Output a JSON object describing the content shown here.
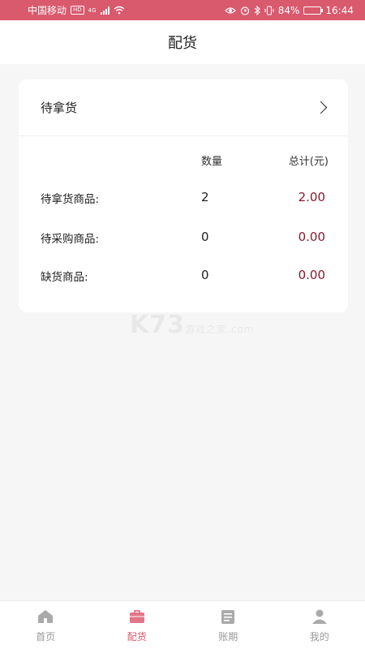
{
  "status_bar": {
    "carrier": "中国移动",
    "hd": "HD",
    "network": "4G",
    "battery": "84%",
    "battery_level": 0.84,
    "time": "16:44"
  },
  "header": {
    "title": "配货"
  },
  "card": {
    "title": "待拿货",
    "col_qty": "数量",
    "col_total": "总计(元)",
    "rows": [
      {
        "label": "待拿货商品:",
        "qty": "2",
        "amount": "2.00"
      },
      {
        "label": "待采购商品:",
        "qty": "0",
        "amount": "0.00"
      },
      {
        "label": "缺货商品:",
        "qty": "0",
        "amount": "0.00"
      }
    ]
  },
  "watermark": {
    "logo": "K73",
    "name": "游戏之家",
    "domain": ".com"
  },
  "tabs": [
    {
      "label": "首页",
      "icon": "home-icon"
    },
    {
      "label": "配货",
      "icon": "bag-icon",
      "active": true
    },
    {
      "label": "账期",
      "icon": "ledger-icon"
    },
    {
      "label": "我的",
      "icon": "user-icon"
    }
  ],
  "colors": {
    "accent": "#d9596d",
    "amount": "#8a1a2e"
  }
}
